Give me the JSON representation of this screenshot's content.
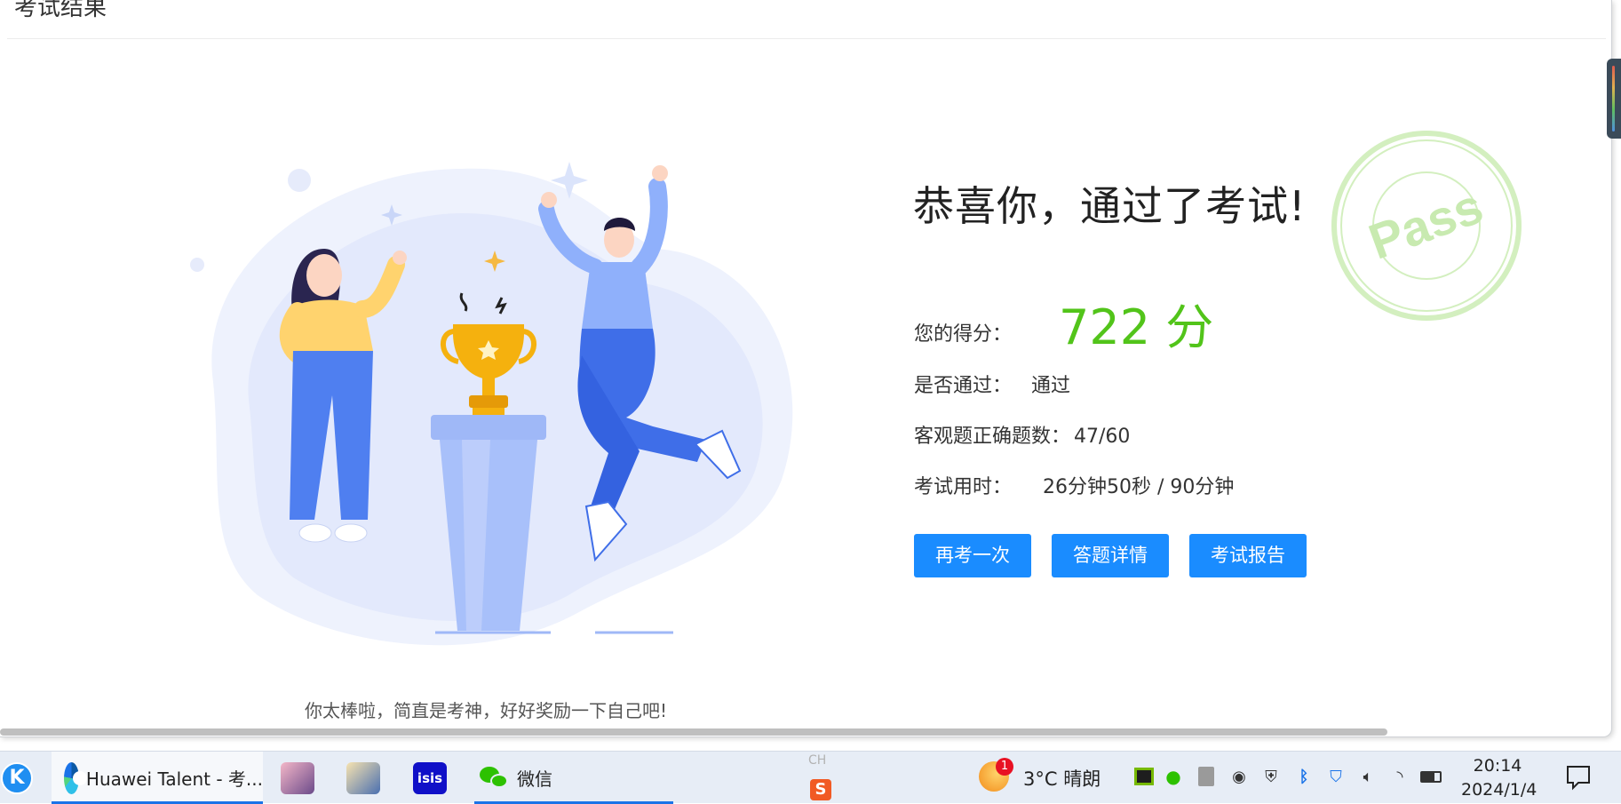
{
  "page": {
    "title": "考试结果",
    "headline": "恭喜你，通过了考试!",
    "caption": "你太棒啦，简直是考神，好好奖励一下自己吧!",
    "stamp_text": "Pass"
  },
  "results": {
    "score_label": "您的得分：",
    "score_value": "722 分",
    "pass_label": "是否通过：",
    "pass_value": "通过",
    "objective_label": "客观题正确题数：",
    "objective_value": "47/60",
    "time_label": "考试用时：",
    "time_value": "26分钟50秒 / 90分钟"
  },
  "buttons": {
    "retake": "再考一次",
    "details": "答题详情",
    "report": "考试报告"
  },
  "colors": {
    "accent": "#1a8cff",
    "score": "#52c41a",
    "stamp": "#c8eab0"
  },
  "taskbar": {
    "edge_label": "Huawei Talent - 考...",
    "wechat_label": "微信",
    "ime_label": "CH",
    "weather_badge": "1",
    "weather": "3°C  晴朗",
    "time": "20:14",
    "date": "2024/1/4",
    "tray_icons": [
      "nvidia-icon",
      "wechat-tray-icon",
      "usb-icon",
      "record-icon",
      "shield-warning-icon",
      "bluetooth-icon",
      "security-icon",
      "volume-icon",
      "wifi-icon",
      "battery-icon"
    ]
  }
}
